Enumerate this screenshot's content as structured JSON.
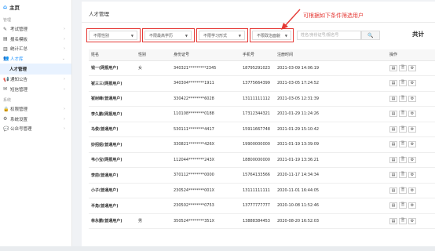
{
  "sidebar": {
    "home": "主页",
    "group1": "管理",
    "items": [
      {
        "label": "考试管理",
        "icon": "edit-icon"
      },
      {
        "label": "报名模板",
        "icon": "template-icon"
      },
      {
        "label": "统计汇总",
        "icon": "bar-chart-icon"
      },
      {
        "label": "人才库",
        "icon": "users-icon"
      }
    ],
    "sub_active": "人才管理",
    "items2": [
      {
        "label": "通知公告",
        "icon": "megaphone-icon"
      },
      {
        "label": "短信管理",
        "icon": "mail-icon"
      }
    ],
    "group2": "系统",
    "items3": [
      {
        "label": "权限管理",
        "icon": "lock-icon"
      },
      {
        "label": "系统设置",
        "icon": "settings-icon"
      },
      {
        "label": "公众号管理",
        "icon": "wechat-icon"
      }
    ]
  },
  "header": {
    "title": "人才管理",
    "hint": "可根据如下条件筛选用户",
    "total": "共计"
  },
  "filters": {
    "gender": "不限性别",
    "education": "不限最高学历",
    "study_form": "不限学习形式",
    "politics": "不限政治面貌",
    "search_placeholder": "姓名/身份证号/报名号"
  },
  "table": {
    "columns": [
      "姓名",
      "性别",
      "身份证号",
      "手机号",
      "注册时间",
      "操作"
    ],
    "rows": [
      {
        "name": "钱一(网报用户)",
        "gender": "女",
        "id": "340321*********2345",
        "phone": "18795291023",
        "time": "2021-03-09 14:06:19"
      },
      {
        "name": "崔三三(网报用户)",
        "gender": "",
        "id": "340304********1911",
        "phone": "13775664399",
        "time": "2021-03-05 17:24:52"
      },
      {
        "name": "崔树峰(普通用户)",
        "gender": "",
        "id": "330422********6028",
        "phone": "13111111112",
        "time": "2021-03-05 12:31:39"
      },
      {
        "name": "李久鹏(网报用户)",
        "gender": "",
        "id": "110108********0188",
        "phone": "17312344321",
        "time": "2021-01-29 11:24:26"
      },
      {
        "name": "马俊(普通用户)",
        "gender": "",
        "id": "530111********4417",
        "phone": "15911667748",
        "time": "2021-01-29 15:10:42"
      },
      {
        "name": "妙招姐(普通用户)",
        "gender": "",
        "id": "330821********426X",
        "phone": "19900000000",
        "time": "2021-01-19 13:39:09"
      },
      {
        "name": "韦小宝(网报用户)",
        "gender": "",
        "id": "112044********243X",
        "phone": "18800000000",
        "time": "2021-01-19 13:36:21"
      },
      {
        "name": "李前(普通用户)",
        "gender": "",
        "id": "370112********0000",
        "phone": "15764133566",
        "time": "2020-11-17 14:34:34"
      },
      {
        "name": "小子(普通用户)",
        "gender": "",
        "id": "230524********001X",
        "phone": "13111111111",
        "time": "2020-11-01 16:44:05"
      },
      {
        "name": "半角(普通用户)",
        "gender": "",
        "id": "230502********0753",
        "phone": "13777777777",
        "time": "2020-10-08 11:52:46"
      },
      {
        "name": "林永鹏(普通用户)",
        "gender": "男",
        "id": "350524********351X",
        "phone": "13888384453",
        "time": "2020-08-20 16:52:03"
      }
    ]
  },
  "colors": {
    "accent": "#1890ff",
    "hint": "#e53935"
  }
}
